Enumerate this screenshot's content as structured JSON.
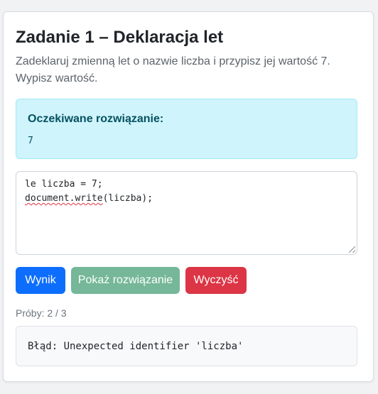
{
  "task": {
    "title": "Zadanie 1 – Deklaracja let",
    "description": "Zadeklaruj zmienną let o nazwie liczba i przypisz jej wartość 7. Wypisz wartość."
  },
  "expected": {
    "label": "Oczekiwane rozwiązanie:",
    "value": "7"
  },
  "editor": {
    "lines": [
      "le liczba = 7;",
      "document.write",
      "(liczba);"
    ]
  },
  "buttons": {
    "run": "Wynik",
    "show_solution": "Pokaż rozwiązanie",
    "clear": "Wyczyść"
  },
  "attempts": "Próby: 2 / 3",
  "output": "Błąd: Unexpected identifier 'liczba'",
  "colors": {
    "primary": "#0d6efd",
    "success_disabled": "#75b798",
    "danger": "#dc3545",
    "info_bg": "#cff4fc",
    "info_text": "#055160"
  }
}
